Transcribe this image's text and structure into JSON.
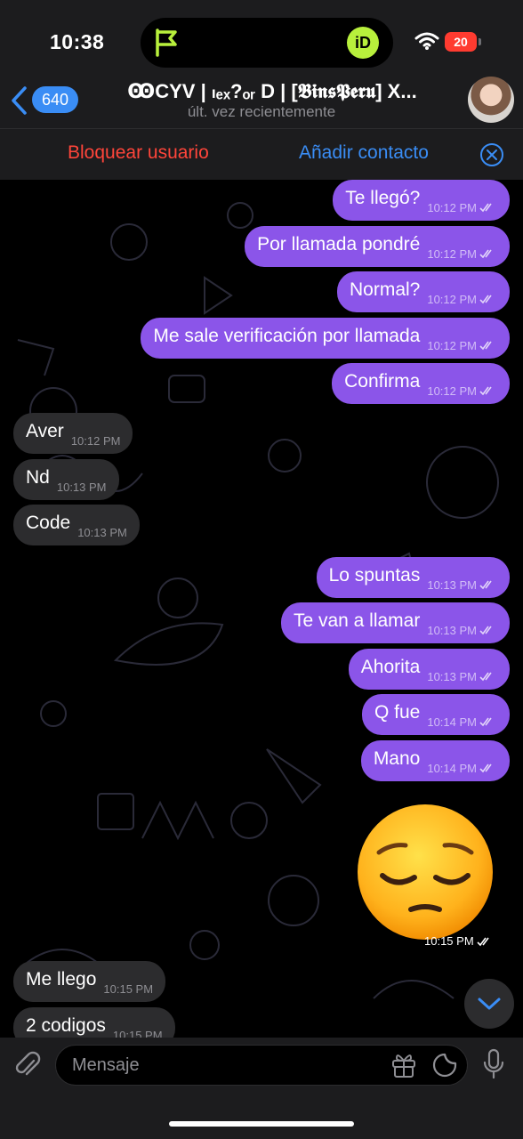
{
  "status_bar": {
    "time": "10:38",
    "battery": "20",
    "island_app": "iD"
  },
  "header": {
    "back_count": "640",
    "title": "ꙬCYV | ₗₑₓ?ₒᵣ D | [𝕭𝖎𝖓𝖘𝕻𝖊𝖗𝖚] X...",
    "subtitle": "últ. vez recientemente"
  },
  "action_bar": {
    "block_label": "Bloquear usuario",
    "add_label": "Añadir contacto"
  },
  "messages": [
    {
      "dir": "out",
      "text": "Te llegó?",
      "time": "10:12 PM"
    },
    {
      "dir": "out",
      "text": "Por llamada pondré",
      "time": "10:12 PM"
    },
    {
      "dir": "out",
      "text": "Normal?",
      "time": "10:12 PM"
    },
    {
      "dir": "out",
      "text": "Me sale verificación por llamada",
      "time": "10:12 PM"
    },
    {
      "dir": "out",
      "text": "Confirma",
      "time": "10:12 PM"
    },
    {
      "dir": "in",
      "text": "Aver",
      "time": "10:12 PM"
    },
    {
      "dir": "in",
      "text": "Nd",
      "time": "10:13 PM"
    },
    {
      "dir": "in",
      "text": "Code",
      "time": "10:13 PM"
    },
    {
      "dir": "out",
      "text": "Lo spuntas",
      "time": "10:13 PM"
    },
    {
      "dir": "out",
      "text": "Te van a llamar",
      "time": "10:13 PM"
    },
    {
      "dir": "out",
      "text": "Ahorita",
      "time": "10:13 PM"
    },
    {
      "dir": "out",
      "text": "Q fue",
      "time": "10:14 PM"
    },
    {
      "dir": "out",
      "text": "Mano",
      "time": "10:14 PM"
    },
    {
      "dir": "out",
      "text": "😔",
      "time": "10:15 PM"
    },
    {
      "dir": "in",
      "text": "Me llego",
      "time": "10:15 PM"
    },
    {
      "dir": "in",
      "text": "2 codigos",
      "time": "10:15 PM"
    }
  ],
  "input": {
    "placeholder": "Mensaje"
  },
  "icons": {
    "back": "chevron-left-icon",
    "close": "close-circle-icon",
    "attach": "paperclip-icon",
    "gift": "gift-icon",
    "sticker": "sticker-icon",
    "mic": "microphone-icon",
    "scroll": "chevron-down-icon",
    "read": "double-check-icon"
  },
  "colors": {
    "outgoing": "#8b55e9",
    "incoming": "#2c2c2e",
    "accent": "#3a8df5",
    "danger": "#ff453a"
  }
}
